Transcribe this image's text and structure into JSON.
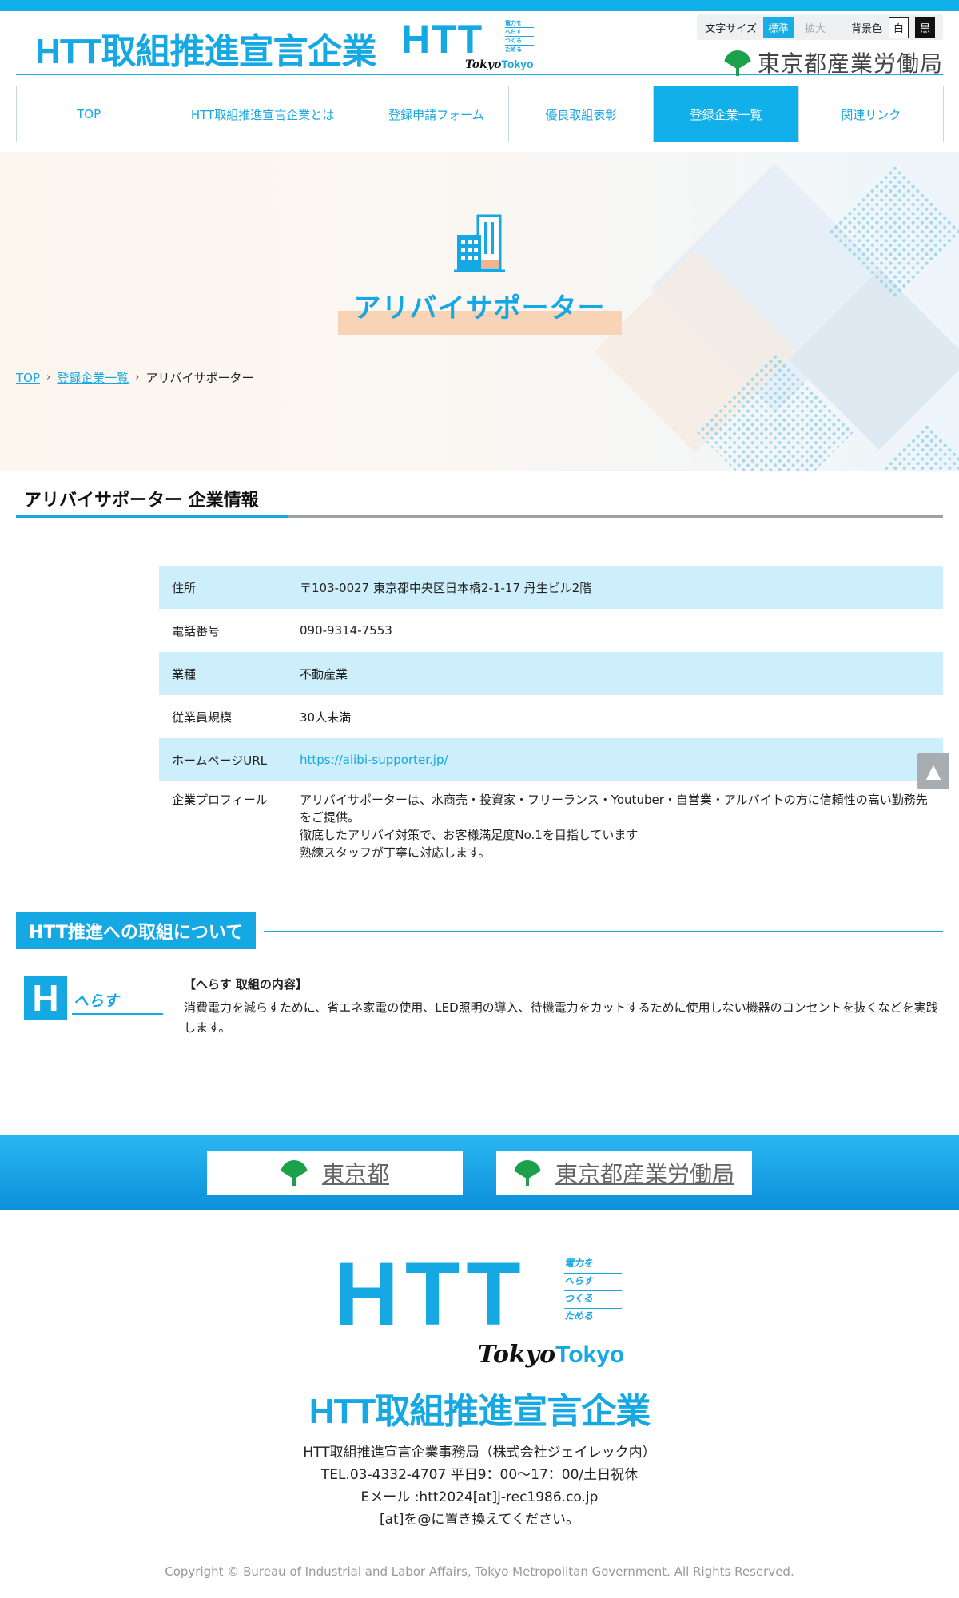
{
  "header": {
    "site_title": "HTT取組推進宣言企業",
    "logo_text": "HTT",
    "logo_lines": [
      "電力を",
      "へらす",
      "つくる",
      "ためる"
    ],
    "logo_tokyo_script": "Tokyo",
    "logo_tokyo": "Tokyo",
    "text_size_label": "文字サイズ",
    "text_size_standard": "標準",
    "text_size_large": "拡大",
    "bg_color_label": "背景色",
    "bg_white": "白",
    "bg_black": "黒",
    "bureau_name": "東京都産業労働局"
  },
  "nav": {
    "items": [
      {
        "label": "TOP"
      },
      {
        "label": "HTT取組推進宣言企業とは"
      },
      {
        "label": "登録申請フォーム"
      },
      {
        "label": "優良取組表彰"
      },
      {
        "label": "登録企業一覧"
      },
      {
        "label": "関連リンク"
      }
    ],
    "active": "登録企業一覧"
  },
  "hero": {
    "title": "アリバイサポーター"
  },
  "breadcrumb": {
    "items": [
      "TOP",
      "登録企業一覧",
      "アリバイサポーター"
    ],
    "separator": "›"
  },
  "company": {
    "section_title": "アリバイサポーター 企業情報",
    "rows": [
      {
        "key": "住所",
        "value": "〒103-0027 東京都中央区日本橋2-1-17 丹生ビル2階"
      },
      {
        "key": "電話番号",
        "value": "090-9314-7553"
      },
      {
        "key": "業種",
        "value": "不動産業"
      },
      {
        "key": "従業員規模",
        "value": "30人未満"
      },
      {
        "key": "ホームページURL",
        "value": "https://alibi-supporter.jp/"
      },
      {
        "key": "企業プロフィール",
        "value_lines": [
          "アリバイサポーターは、水商売・投資家・フリーランス・Youtuber・自営業・アルバイトの方に信頼性の高い勤務先をご提供。",
          "徹底したアリバイ対策で、お客様満足度No.1を目指しています",
          "熟練スタッフが丁寧に対応します。"
        ]
      }
    ]
  },
  "page_top_icon": "arrow-up-icon",
  "htt": {
    "section_title": "HTT推進への取組について",
    "logo_letter": "H",
    "logo_name": "へらす",
    "content_heading": "【へらす 取組の内容】",
    "content_text": "消費電力を減らすために、省エネ家電の使用、LED照明の導入、待機電力をカットするために使用しない機器のコンセントを抜くなどを実践します。"
  },
  "footer": {
    "link_tokyo": "東京都",
    "link_bureau": "東京都産業労働局",
    "logo_text": "HTT",
    "logo_lines": [
      "電力を",
      "へらす",
      "つくる",
      "ためる"
    ],
    "logo_tokyo_script": "Tokyo",
    "logo_tokyo": "Tokyo",
    "title": "HTT取組推進宣言企業",
    "office": "HTT取組推進宣言企業事務局（株式会社ジェイレック内）",
    "tel": "TEL.03-4332-4707 平日9：00～17：00/土日祝休",
    "email": "Eメール :htt2024[at]j-rec1986.co.jp",
    "note": "[at]を@に置き換えてください。",
    "copyright": "Copyright © Bureau of Industrial and Labor Affairs, Tokyo Metropolitan Government. All Rights Reserved."
  },
  "colors": {
    "brand": "#16a8e2",
    "row_alt": "#cdeefb",
    "hero_highlight": "#f9d3b6",
    "ginkgo": "#1aa14a"
  }
}
